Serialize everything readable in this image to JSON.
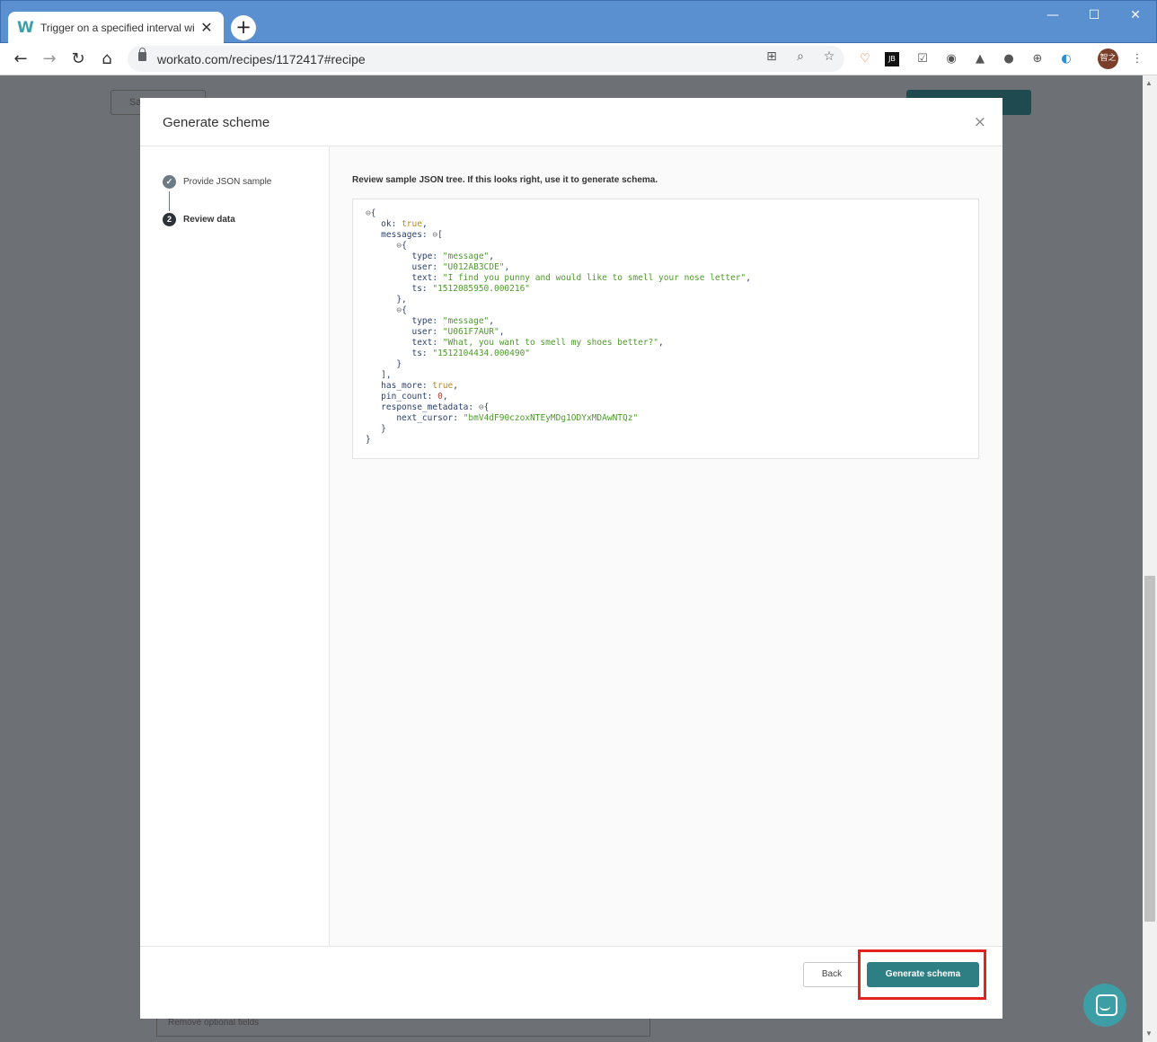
{
  "browser": {
    "tab_title": "Trigger on a specified interval wi",
    "favicon": "W",
    "url": "workato.com/recipes/1172417#recipe",
    "profile_initials": "智之"
  },
  "page_bg": {
    "ghost_left": "Sa",
    "ghost_bottom": "Remove optional fields"
  },
  "modal": {
    "title": "Generate scheme",
    "steps": [
      {
        "number": "✓",
        "label": "Provide JSON sample"
      },
      {
        "number": "2",
        "label": "Review data"
      }
    ],
    "instruction": "Review sample JSON tree. If this looks right, use it to generate schema.",
    "json": {
      "ok_key": "ok",
      "ok_val": "true",
      "messages_key": "messages",
      "msg1": {
        "type": "\"message\"",
        "user": "\"U012AB3CDE\"",
        "text": "\"I find you punny and would like to smell your nose letter\"",
        "ts": "\"1512085950.000216\""
      },
      "msg2": {
        "type": "\"message\"",
        "user": "\"U061F7AUR\"",
        "text": "\"What, you want to smell my shoes better?\"",
        "ts": "\"1512104434.000490\""
      },
      "has_more_key": "has_more",
      "has_more_val": "true",
      "pin_count_key": "pin_count",
      "pin_count_val": "0",
      "response_metadata_key": "response_metadata",
      "next_cursor_key": "next_cursor",
      "next_cursor_val": "\"bmV4dF90czoxNTEyMDg1ODYxMDAwNTQz\""
    },
    "back_label": "Back",
    "generate_label": "Generate schema"
  },
  "colors": {
    "primary": "#2e7f84",
    "highlight": "#e32222"
  }
}
